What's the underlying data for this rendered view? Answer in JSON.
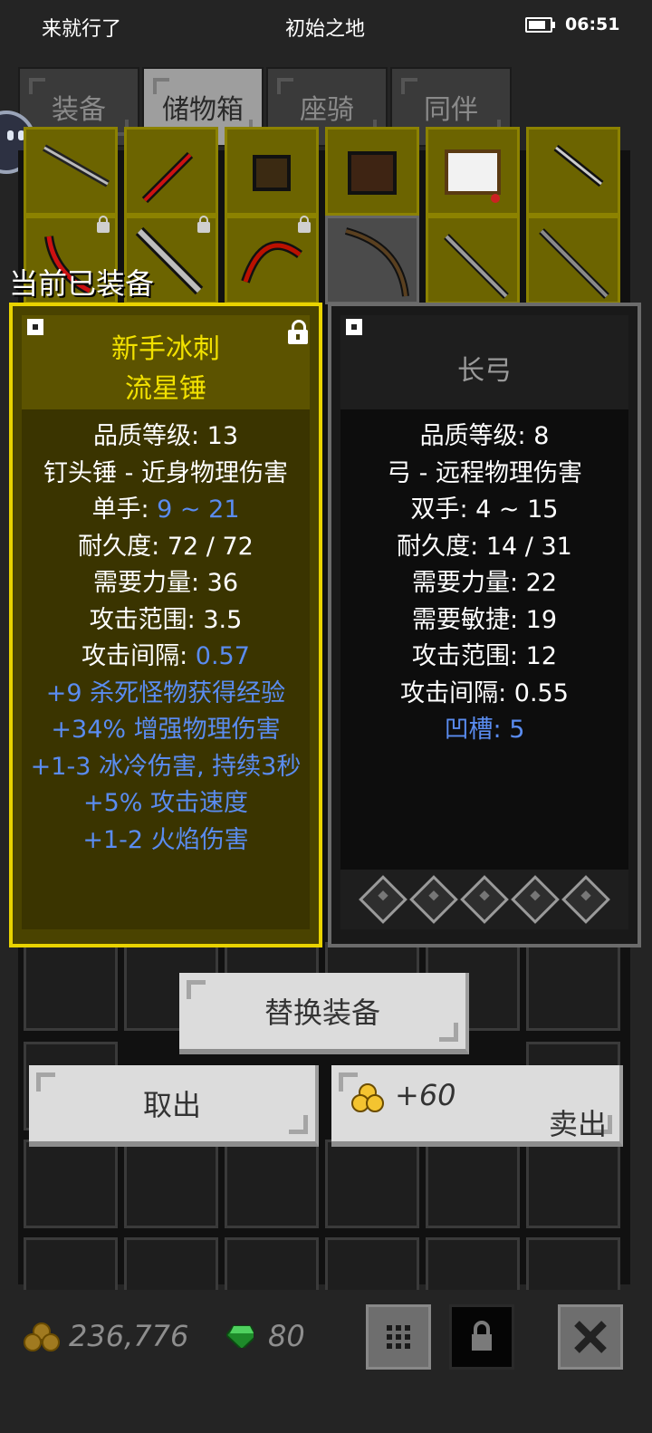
{
  "status_bar": {
    "left": "来就行了",
    "center": "初始之地",
    "time": "06:51",
    "battery_percent": 80
  },
  "tabs": [
    {
      "label": "装备",
      "active": false
    },
    {
      "label": "储物箱",
      "active": true
    },
    {
      "label": "座骑",
      "active": false
    },
    {
      "label": "同伴",
      "active": false
    }
  ],
  "current_equipped_label": "当前已装备",
  "left_item": {
    "name_line1": "新手冰刺",
    "name_line2": "流星锤",
    "locked": true,
    "stats": [
      {
        "text": "品质等级: 13"
      },
      {
        "text": "钉头锤 - 近身物理伤害"
      },
      {
        "label": "单手: ",
        "value": "9 ~ 21",
        "value_highlight": true
      },
      {
        "text": "耐久度: 72 / 72"
      },
      {
        "text": "需要力量: 36"
      },
      {
        "text": "攻击范围: 3.5"
      },
      {
        "label": "攻击间隔: ",
        "value": "0.57",
        "value_highlight": true
      },
      {
        "text": "+9 杀死怪物获得经验",
        "highlight": true
      },
      {
        "text": "+34% 增强物理伤害",
        "highlight": true
      },
      {
        "text": "+1-3 冰冷伤害, 持续3秒",
        "highlight": true
      },
      {
        "text": "+5% 攻击速度",
        "highlight": true
      },
      {
        "text": "+1-2 火焰伤害",
        "highlight": true
      }
    ]
  },
  "right_item": {
    "name": "长弓",
    "stats": [
      {
        "text": "品质等级: 8"
      },
      {
        "text": "弓 - 远程物理伤害"
      },
      {
        "text": "双手: 4 ~ 15"
      },
      {
        "text": "耐久度: 14 / 31"
      },
      {
        "text": "需要力量: 22"
      },
      {
        "text": "需要敏捷: 19"
      },
      {
        "text": "攻击范围: 12"
      },
      {
        "text": "攻击间隔: 0.55"
      },
      {
        "text": "凹槽: 5",
        "highlight": true
      }
    ],
    "socket_count": 5
  },
  "buttons": {
    "replace": "替换装备",
    "take_out": "取出",
    "sell_price": "+60",
    "sell": "卖出"
  },
  "footer": {
    "gold": "236,776",
    "gems": "80"
  },
  "colors": {
    "accent_yellow": "#e9d300",
    "stat_blue": "#5a8cf0",
    "background": "#242424"
  }
}
